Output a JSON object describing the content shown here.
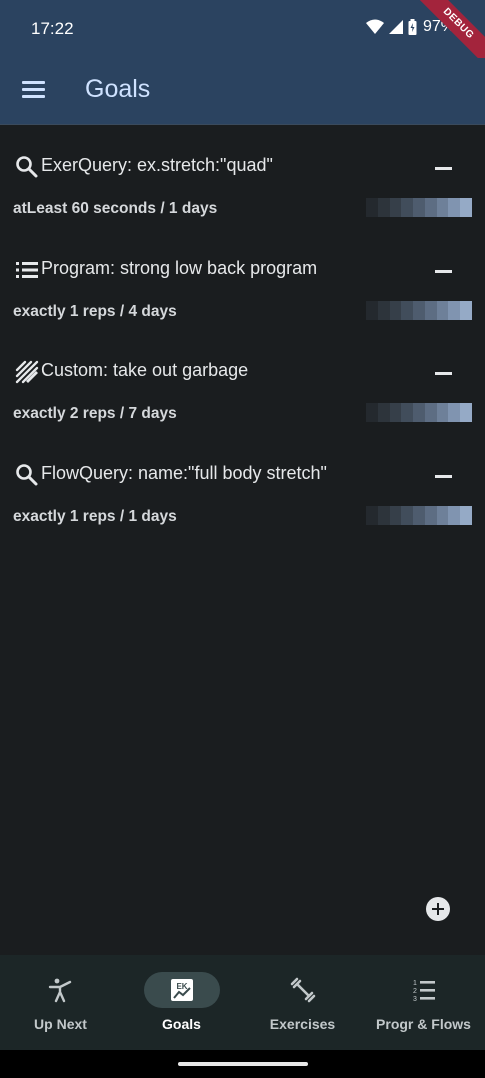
{
  "status_bar": {
    "time": "17:22",
    "battery": "97%",
    "debug_banner": "DEBUG"
  },
  "app_bar": {
    "title": "Goals"
  },
  "goals": [
    {
      "icon": "search-icon",
      "title": "ExerQuery: ex.stretch:\"quad\"",
      "subtitle": "atLeast 60 seconds / 1 days"
    },
    {
      "icon": "list-icon",
      "title": "Program: strong low back program",
      "subtitle": "exactly 1 reps / 4 days"
    },
    {
      "icon": "custom-pencil-icon",
      "title": "Custom: take out garbage",
      "subtitle": "exactly 2 reps / 7 days"
    },
    {
      "icon": "search-icon",
      "title": "FlowQuery: name:\"full body stretch\"",
      "subtitle": "exactly 1 reps / 1 days"
    }
  ],
  "progress_colors": [
    "#24292e",
    "#2d343b",
    "#363f49",
    "#414d5b",
    "#4e5c6e",
    "#5d6d83",
    "#6e8099",
    "#8094b0",
    "#95aac6"
  ],
  "nav": {
    "items": [
      {
        "label": "Up Next",
        "icon": "person-stretch-icon",
        "active": false
      },
      {
        "label": "Goals",
        "icon": "goals-chart-icon",
        "active": true
      },
      {
        "label": "Exercises",
        "icon": "dumbbell-icon",
        "active": false
      },
      {
        "label": "Progr & Flows",
        "icon": "numbered-list-icon",
        "active": false
      }
    ]
  },
  "colors": {
    "app_bar": "#2b4360",
    "background": "#1a1d1f",
    "title": "#cfe2ff",
    "nav_bg": "#1c2627",
    "active_pill": "#3a4b4d",
    "debug": "#a3243c"
  }
}
